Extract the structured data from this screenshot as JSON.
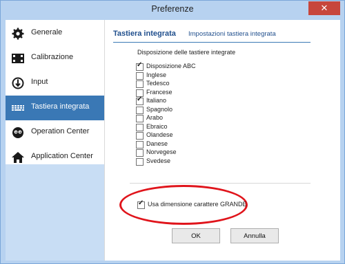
{
  "window": {
    "title": "Preferenze",
    "close_glyph": "✕"
  },
  "sidebar": {
    "items": [
      {
        "label": "Generale",
        "icon": "gear-icon"
      },
      {
        "label": "Calibrazione",
        "icon": "calibration-icon"
      },
      {
        "label": "Input",
        "icon": "input-icon"
      },
      {
        "label": "Tastiera integrata",
        "icon": "keyboard-icon",
        "active": true
      },
      {
        "label": "Operation Center",
        "icon": "operation-center-icon"
      },
      {
        "label": "Application Center",
        "icon": "home-icon"
      }
    ]
  },
  "main": {
    "tab_title": "Tastiera integrata",
    "tab_link": "Impostazioni tastiera integrata",
    "group_label": "Disposizione delle tastiere integrate",
    "checkboxes": [
      {
        "label": "Disposizione ABC",
        "checked": true
      },
      {
        "label": "Inglese",
        "checked": false
      },
      {
        "label": "Tedesco",
        "checked": false
      },
      {
        "label": "Francese",
        "checked": false
      },
      {
        "label": "Italiano",
        "checked": true
      },
      {
        "label": "Spagnolo",
        "checked": false
      },
      {
        "label": "Arabo",
        "checked": false
      },
      {
        "label": "Ebraico",
        "checked": false
      },
      {
        "label": "Olandese",
        "checked": false
      },
      {
        "label": "Danese",
        "checked": false
      },
      {
        "label": "Norvegese",
        "checked": false
      },
      {
        "label": "Svedese",
        "checked": false
      }
    ],
    "large_font": {
      "label": "Usa dimensione carattere GRANDE",
      "checked": true
    },
    "ok_label": "OK",
    "cancel_label": "Annulla"
  },
  "colors": {
    "accent": "#3a78b5",
    "highlight": "#e0141b",
    "close": "#c7463c"
  }
}
